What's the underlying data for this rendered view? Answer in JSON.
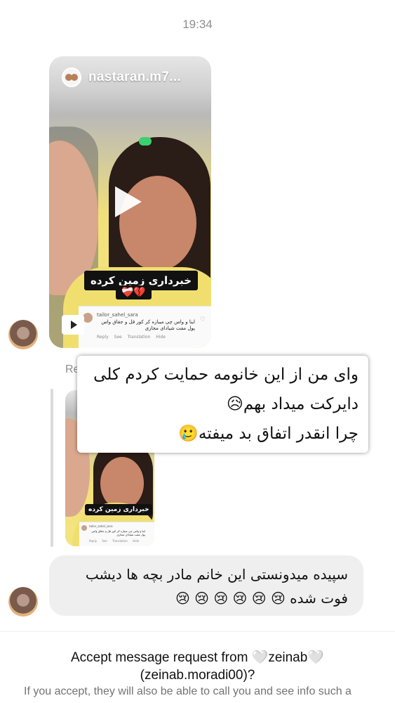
{
  "status": {
    "time": "19:34"
  },
  "reel": {
    "username": "nastaran.m7...",
    "caption": "خبرداری زمین کرده",
    "caption_emoji": "❤️‍🩹💔",
    "comment_user": "tailor_sahel_sara",
    "comment_text": "اینا و واس چی میبازه کر کور قل و جقاق واس پول مفت شیادای مجازی",
    "comment_actions": "Reply See Translation Hide"
  },
  "reply": {
    "label": "Re",
    "thumb_caption": "خبرداری زمین کرده"
  },
  "overlay_message": {
    "lines": [
      "وای من از این خانومه حمایت کردم کلی",
      "دایرکت میداد بهم😥",
      "چرا انقدر اتفاق بد میفته🥲"
    ]
  },
  "incoming_message": {
    "lines": [
      "سپیده میدونستی این خانم مادر بچه ها دیشب",
      "فوت شده 😢 😢 😢 😢 😢 😢"
    ]
  },
  "message_request": {
    "title_line1": "Accept message request from 🤍zeinab🤍",
    "title_line2": "(zeinab.moradi00)?",
    "subtitle": "If you accept, they will also be able to call you and see info such a"
  },
  "icons": {
    "play": "play-icon",
    "reels": "reels-icon",
    "heart": "heart-outline-icon"
  }
}
